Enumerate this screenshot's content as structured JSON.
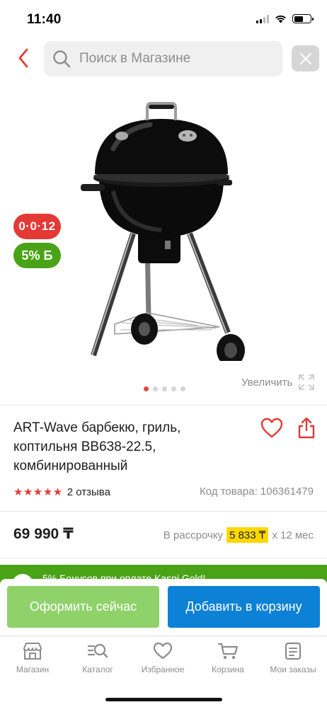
{
  "status_bar": {
    "time": "11:40"
  },
  "header": {
    "search_placeholder": "Поиск в Магазине"
  },
  "gallery": {
    "badge_installment": "0·0·12",
    "badge_bonus": "5% Б",
    "zoom_label": "Увеличить",
    "dots_total": 5,
    "active_dot": 1
  },
  "product": {
    "title_line1": "ART-Wave барбекю, гриль,",
    "title_line2": "коптильня BB638-22.5,",
    "title_line3": "комбинированный",
    "rating_stars": 5,
    "reviews": "2 отзыва",
    "sku_label": "Код товара: 106361479",
    "price": "69 990 ₸",
    "installment_prefix": "В рассрочку",
    "installment_amount": "5 833 ₸",
    "installment_suffix": "x 12 мес"
  },
  "promo_strip": {
    "text": "5% Бонусов при оплате Kaspi Gold!"
  },
  "actions": {
    "buy_now": "Оформить сейчас",
    "add_to_cart": "Добавить в корзину"
  },
  "tabs": [
    {
      "label": "Магазин",
      "icon": "store-icon"
    },
    {
      "label": "Каталог",
      "icon": "catalog-search-icon"
    },
    {
      "label": "Избранное",
      "icon": "heart-icon"
    },
    {
      "label": "Корзина",
      "icon": "cart-icon"
    },
    {
      "label": "Мои заказы",
      "icon": "orders-icon"
    }
  ],
  "colors": {
    "accent_red": "#e53935",
    "bonus_green": "#4aa317",
    "buy_now_green": "#8fd26a",
    "cart_blue": "#0c81d6",
    "installment_yellow": "#ffd800"
  }
}
